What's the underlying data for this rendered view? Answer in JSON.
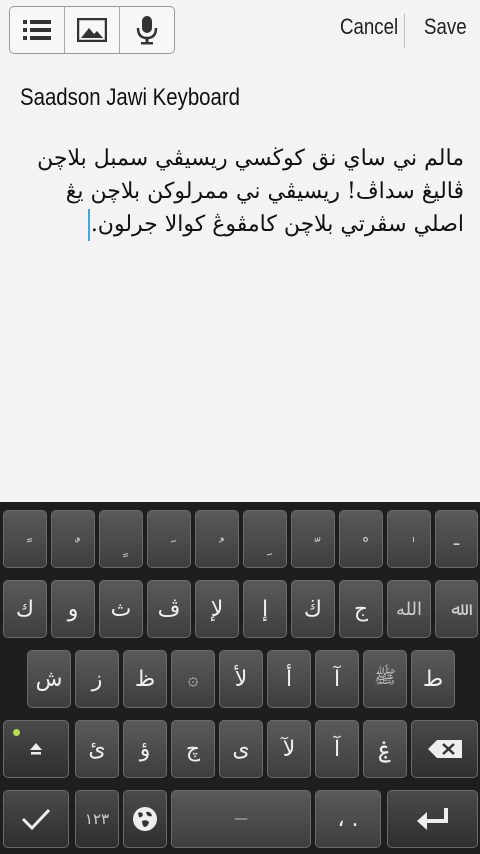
{
  "toolbar": {
    "list_icon": "list-icon",
    "image_icon": "image-icon",
    "mic_icon": "microphone-icon",
    "cancel_label": "Cancel",
    "save_label": "Save"
  },
  "note": {
    "title": "Saadson Jawi Keyboard",
    "body": "مالم ني ساي نق كوڬسي ريسيڤي سمبل بلاچن ڤاليڠ سداڤ! ريسيڤي ني ممرلوكن بلاچن يڠ اصلي سڤرتي بلاچن كامڤوڠ كوالا جرلون."
  },
  "keyboard": {
    "row1": [
      "ً",
      "ٌ",
      "ٍ",
      "َ",
      "ُ",
      "ِ",
      "ّ",
      "ْ",
      "ٰ",
      "ـ"
    ],
    "row2": [
      "ك",
      "و",
      "ث",
      "ڤ",
      "لإ",
      "إ",
      "ڬ",
      "ج",
      "الله",
      "ﷲ"
    ],
    "row3": [
      "ش",
      "ز",
      "ظ",
      "۞",
      "لأ",
      "أ",
      "آ",
      "ﷺ",
      "ط"
    ],
    "row4": [
      "ئ",
      "ؤ",
      "چ",
      "ى",
      "لآ",
      "آ",
      "ۼ"
    ],
    "shift": "shift-icon",
    "backspace": "backspace-icon",
    "done": "checkmark-icon",
    "numbers_label": "١٢٣",
    "globe": "globe-icon",
    "space_label": "—",
    "punct_label": "، .",
    "enter": "enter-icon"
  }
}
